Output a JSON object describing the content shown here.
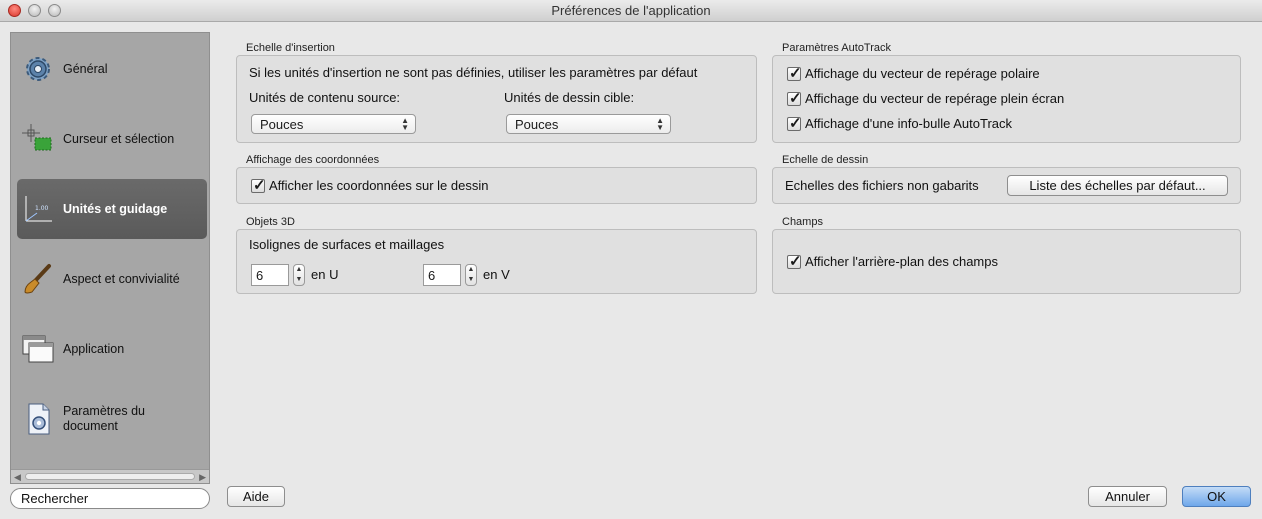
{
  "window": {
    "title": "Préférences de l'application"
  },
  "sidebar": {
    "items": [
      {
        "label": "Général",
        "icon": "gear-icon"
      },
      {
        "label": "Curseur et sélection",
        "icon": "cursor-selection-icon"
      },
      {
        "label": "Unités et guidage",
        "icon": "units-guide-icon",
        "active": true
      },
      {
        "label": "Aspect et convivialité",
        "icon": "brush-icon"
      },
      {
        "label": "Application",
        "icon": "windows-icon"
      },
      {
        "label": "Paramètres du document",
        "icon": "document-settings-icon"
      }
    ],
    "search_placeholder": "Rechercher"
  },
  "insertion": {
    "title": "Echelle d'insertion",
    "description": "Si les unités d'insertion ne sont pas définies, utiliser les paramètres par défaut",
    "source_label": "Unités de contenu source:",
    "source_value": "Pouces",
    "target_label": "Unités de dessin cible:",
    "target_value": "Pouces"
  },
  "coords": {
    "title": "Affichage des coordonnées",
    "checkbox_label": "Afficher les coordonnées sur le dessin",
    "checked": true
  },
  "objects3d": {
    "title": "Objets 3D",
    "subtitle": "Isolignes de surfaces et maillages",
    "u_value": "6",
    "u_label": "en U",
    "v_value": "6",
    "v_label": "en V"
  },
  "autotrack": {
    "title": "Paramètres AutoTrack",
    "options": [
      {
        "label": "Affichage du vecteur de repérage polaire",
        "checked": true
      },
      {
        "label": "Affichage du vecteur de repérage plein écran",
        "checked": true
      },
      {
        "label": "Affichage d'une info-bulle AutoTrack",
        "checked": true
      }
    ]
  },
  "drawing_scale": {
    "title": "Echelle de dessin",
    "label": "Echelles des fichiers non gabarits",
    "button": "Liste des échelles par défaut..."
  },
  "fields": {
    "title": "Champs",
    "checkbox_label": "Afficher l'arrière-plan des champs",
    "checked": true
  },
  "footer": {
    "help": "Aide",
    "cancel": "Annuler",
    "ok": "OK"
  },
  "colors": {
    "sidebar_bg": "#a6a6a6",
    "sidebar_active": "#5f5f5f",
    "primary_button": "#6fa7ea"
  }
}
